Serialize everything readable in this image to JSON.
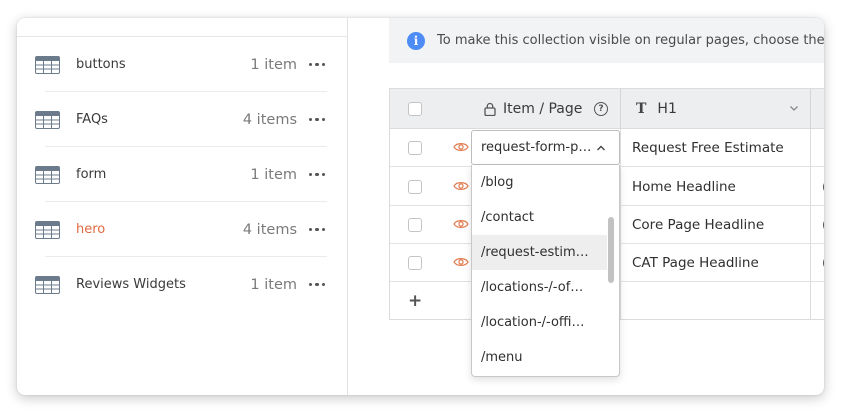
{
  "sidebar": {
    "collections": [
      {
        "name": "buttons",
        "count": "1 item",
        "active": false
      },
      {
        "name": "FAQs",
        "count": "4 items",
        "active": false
      },
      {
        "name": "form",
        "count": "1 item",
        "active": false
      },
      {
        "name": "hero",
        "count": "4 items",
        "active": true
      },
      {
        "name": "Reviews Widgets",
        "count": "1 item",
        "active": false
      }
    ]
  },
  "banner": {
    "icon": "info-icon",
    "text": "To make this collection visible on regular pages, choose the relev"
  },
  "grid": {
    "columns": {
      "item_page": "Item / Page",
      "h1": "H1"
    },
    "rows": [
      {
        "h1": "Request Free Estimate",
        "extra": ""
      },
      {
        "h1": "Home Headline",
        "extra": "("
      },
      {
        "h1": "Core Page Headline",
        "extra": "("
      },
      {
        "h1": "CAT Page Headline",
        "extra": "("
      }
    ],
    "add_label": "+"
  },
  "dropdown": {
    "selected": "request-form-p…",
    "options": [
      "/blog",
      "/contact",
      "/request-estim…",
      "/locations-/-of…",
      "/location-/-offi…",
      "/menu"
    ],
    "highlighted_index": 2
  },
  "colors": {
    "accent_orange": "#e06a3e",
    "info_blue": "#4d8cf5",
    "header_bg": "#eceef0"
  }
}
